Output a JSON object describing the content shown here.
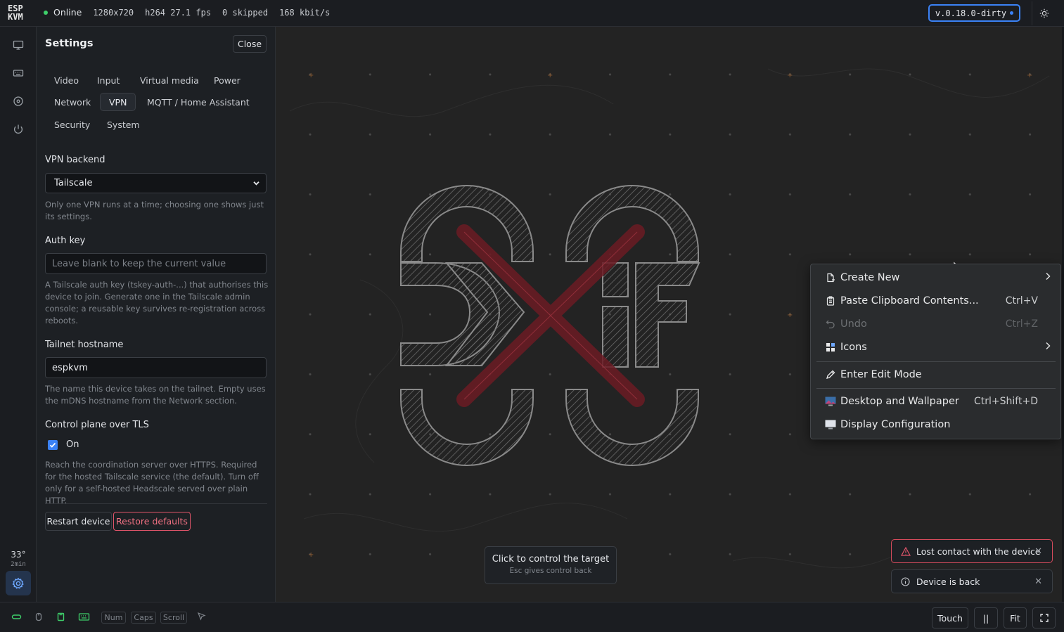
{
  "header": {
    "logo_line1": "ESP",
    "logo_line2": "KVM",
    "status": "Online",
    "resolution": "1280x720",
    "codec_fps": "h264 27.1 fps",
    "skipped": "0 skipped",
    "bitrate": "168 kbit/s",
    "version": "v.0.18.0-dirty",
    "colors": {
      "online": "#3ecf6a",
      "accent": "#3b82f6",
      "danger": "#e2556a"
    }
  },
  "rail": {
    "icons": [
      "monitor-icon",
      "keyboard-icon",
      "disc-icon",
      "power-icon"
    ],
    "temperature": "33°",
    "uptime": "2min"
  },
  "settings": {
    "title": "Settings",
    "close_label": "Close",
    "tabs": [
      {
        "label": "Video"
      },
      {
        "label": "Input"
      },
      {
        "label": "Virtual media"
      },
      {
        "label": "Power"
      },
      {
        "label": "Network"
      },
      {
        "label": "VPN",
        "active": true
      },
      {
        "label": "MQTT / Home Assistant"
      },
      {
        "label": "Security"
      },
      {
        "label": "System"
      }
    ],
    "vpn_backend": {
      "label": "VPN backend",
      "value": "Tailscale",
      "help": "Only one VPN runs at a time; choosing one shows just its settings."
    },
    "auth_key": {
      "label": "Auth key",
      "placeholder": "Leave blank to keep the current value",
      "help": "A Tailscale auth key (tskey-auth-...) that authorises this device to join. Generate one in the Tailscale admin console; a reusable key survives re-registration across reboots."
    },
    "hostname": {
      "label": "Tailnet hostname",
      "value": "espkvm",
      "help": "The name this device takes on the tailnet. Empty uses the mDNS hostname from the Network section."
    },
    "tls": {
      "label": "Control plane over TLS",
      "checkbox_label": "On",
      "checked": true,
      "help": "Reach the coordination server over HTTPS. Required for the hosted Tailscale service (the default). Turn off only for a self-hosted Headscale served over plain HTTP."
    },
    "restart_label": "Restart device",
    "restore_label": "Restore defaults"
  },
  "context_menu": {
    "items": [
      {
        "label": "Create New",
        "icon": "new-file-icon",
        "submenu": true
      },
      {
        "label": "Paste Clipboard Contents...",
        "icon": "clipboard-icon",
        "shortcut": "Ctrl+V"
      },
      {
        "label": "Undo",
        "icon": "undo-icon",
        "shortcut": "Ctrl+Z",
        "disabled": true
      },
      {
        "label": "Icons",
        "icon": "grid-icon",
        "submenu": true
      },
      {
        "label": "Enter Edit Mode",
        "icon": "pencil-icon"
      },
      {
        "label": "Desktop and Wallpaper",
        "icon": "wallpaper-icon",
        "shortcut": "Ctrl+Shift+D"
      },
      {
        "label": "Display Configuration",
        "icon": "display-icon"
      }
    ]
  },
  "control_tip": {
    "title": "Click to control the target",
    "subtitle": "Esc gives control back"
  },
  "toasts": [
    {
      "text": "Lost contact with the device",
      "kind": "error"
    },
    {
      "text": "Device is back",
      "kind": "info"
    }
  ],
  "footer": {
    "lock_keys": [
      "Num",
      "Caps",
      "Scroll"
    ],
    "touch_label": "Touch",
    "pause_label": "||",
    "fit_label": "Fit"
  }
}
